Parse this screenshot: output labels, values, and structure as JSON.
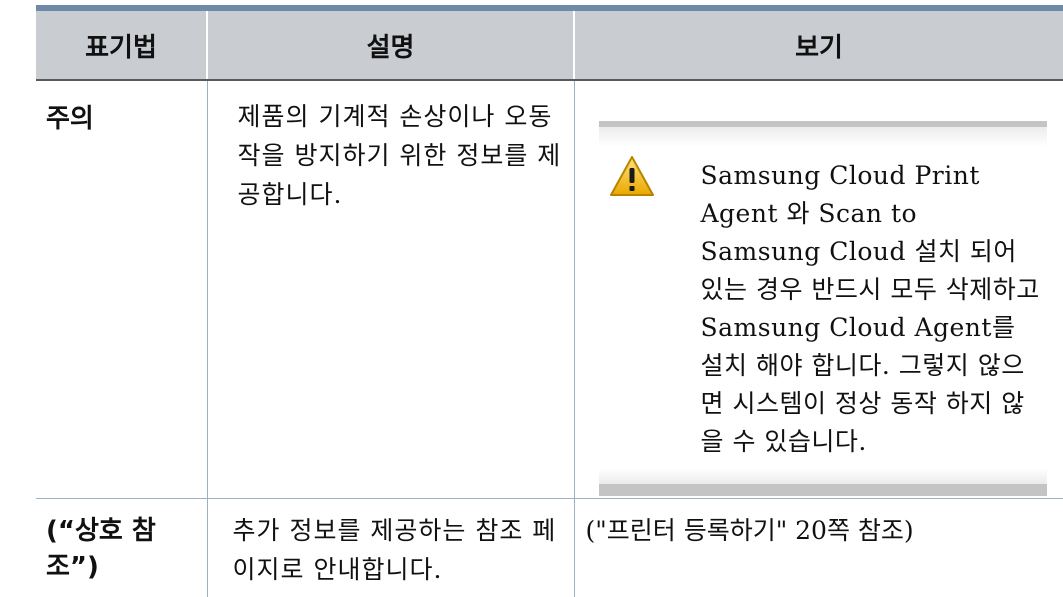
{
  "table": {
    "headers": [
      "표기법",
      "설명",
      "보기"
    ],
    "rows": [
      {
        "term": "주의",
        "description": "제품의 기계적 손상이나 오동작을 방지하기 위한 정보를 제공합니다.",
        "example": {
          "icon": "warning-triangle-icon",
          "text": "Samsung Cloud Print Agent 와 Scan to Samsung Cloud 설치 되어 있는 경우 반드시 모두 삭제하고 Samsung Cloud Agent를 설치 해야 합니다. 그렇지 않으면 시스템이 정상 동작 하지 않을 수 있습니다."
        }
      },
      {
        "term": "(“상호 참조”)",
        "description": "추가 정보를 제공하는 참조 페이지로 안내합니다.",
        "example": {
          "text": "(\"프린터 등록하기\" 20쪽 참조)"
        }
      }
    ]
  },
  "colors": {
    "header_bg": "#c9cdd2",
    "header_top_rule": "#6d8aa9",
    "cell_divider": "#9fb0c4",
    "caution_frame": "#c4c4c4",
    "warning_fill": "#f5c518"
  }
}
